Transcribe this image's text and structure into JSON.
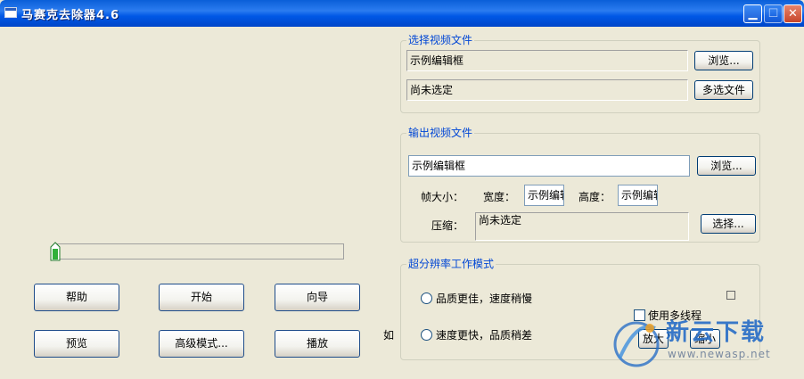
{
  "window": {
    "title": "马赛克去除器4.6"
  },
  "input_group": {
    "label": "选择视频文件",
    "edit_value": "示例编辑框",
    "status_value": "尚未选定",
    "browse_label": "浏览...",
    "multi_label": "多选文件"
  },
  "output_group": {
    "label": "输出视频文件",
    "edit_value": "示例编辑框",
    "browse_label": "浏览...",
    "frame_size_label": "帧大小：",
    "width_label": "宽度：",
    "width_value": "示例编辑",
    "height_label": "高度：",
    "height_value": "示例编辑",
    "compress_label": "压缩：",
    "compress_value": "尚未选定",
    "select_label": "选择..."
  },
  "mode_group": {
    "label": "超分辨率工作模式",
    "option_quality": "品质更佳，速度稍慢",
    "option_speed": "速度更快，品质稍差",
    "multithread_label": "使用多线程",
    "zoom_in_label": "放大",
    "zoom_out_label": "缩小",
    "stray_char": "如"
  },
  "buttons": {
    "help": "帮助",
    "start": "开始",
    "wizard": "向导",
    "preview": "预览",
    "advanced": "高级模式...",
    "play": "播放"
  },
  "progress": {
    "value": 0
  },
  "watermark": {
    "brand": "新云下载",
    "url": "www.newasp.net"
  },
  "colors": {
    "title_bar": "#0a5fd8",
    "group_label": "#0046d5",
    "face": "#ece9d8"
  }
}
